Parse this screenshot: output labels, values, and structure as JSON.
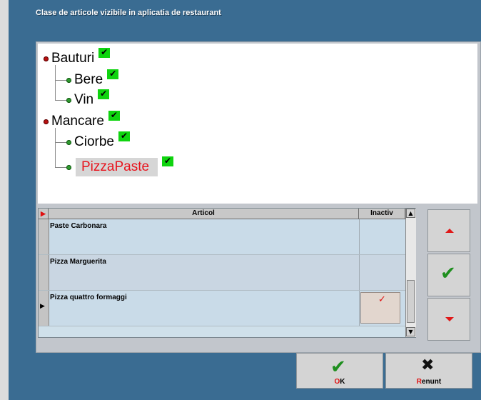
{
  "window": {
    "title": "Clase de articole vizibile in aplicatia de restaurant"
  },
  "tree": {
    "nodes": [
      {
        "label": "Bauturi",
        "level": 0,
        "checked": true
      },
      {
        "label": "Bere",
        "level": 1,
        "checked": true
      },
      {
        "label": "Vin",
        "level": 1,
        "checked": true
      },
      {
        "label": "Mancare",
        "level": 0,
        "checked": true
      },
      {
        "label": "Ciorbe",
        "level": 1,
        "checked": true
      },
      {
        "label": "PizzaPaste",
        "level": 1,
        "checked": true,
        "selected": true
      }
    ],
    "check_glyph": "✔"
  },
  "grid": {
    "columns": {
      "articol": "Articol",
      "inactiv": "Inactiv"
    },
    "rows": [
      {
        "articol": "Paste Carbonara",
        "inactiv": false
      },
      {
        "articol": "Pizza Marguerita",
        "inactiv": false
      },
      {
        "articol": "Pizza quattro formaggi",
        "inactiv": false
      }
    ],
    "current_row_marker": "▶",
    "current_col_marker": "▶",
    "inactiv_mark": "✓"
  },
  "side_buttons": {
    "confirm_glyph": "✔"
  },
  "footer": {
    "ok": {
      "hot": "O",
      "rest": "K",
      "glyph": "✔"
    },
    "cancel": {
      "hot": "R",
      "rest": "enunt",
      "glyph": "✖"
    }
  },
  "colors": {
    "frame": "#3a6c92",
    "check_bg": "#0fd40f",
    "selected_text": "#e8131d",
    "hotkey": "#e01010"
  }
}
